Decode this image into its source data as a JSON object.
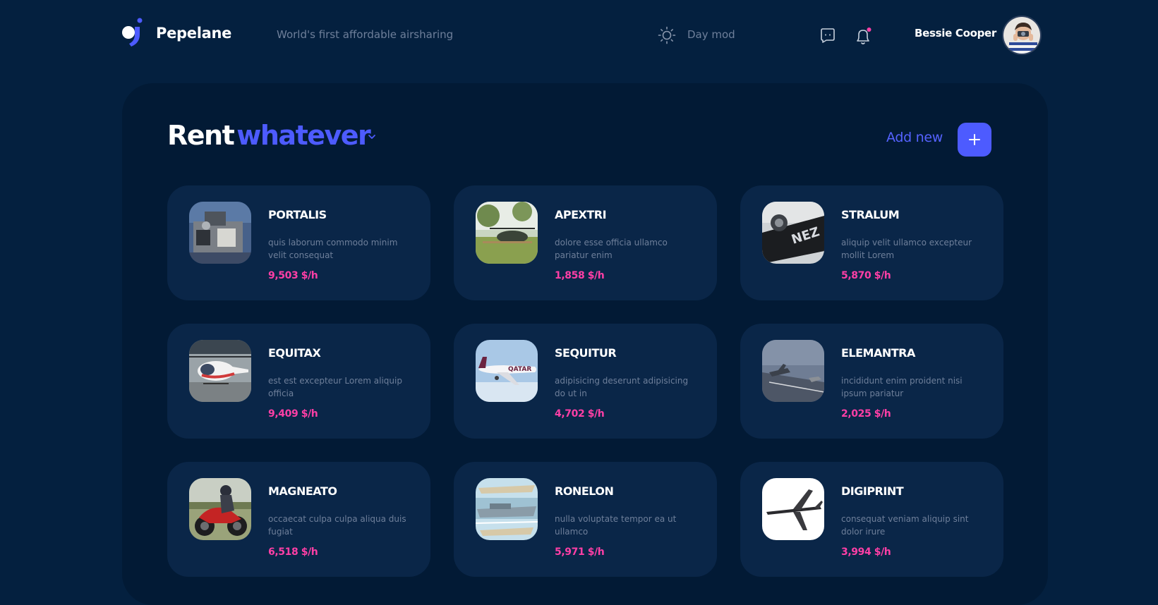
{
  "header": {
    "brand": "Pepelane",
    "tagline": "World's first affordable airsharing",
    "day_mode_label": "Day mod",
    "username": "Bessie Cooper",
    "icons": [
      "logo-icon",
      "sun-icon",
      "message-icon",
      "bell-icon"
    ]
  },
  "main": {
    "title_part1": "Rent",
    "title_part2": "whatever",
    "add_new_label": "Add new",
    "add_button_symbol": "+"
  },
  "colors": {
    "background": "#04203f",
    "panel": "#021a35",
    "card": "#0a2648",
    "accent": "#4d5bff",
    "price": "#ff3fa6",
    "muted": "#6e7f9a"
  },
  "cards": [
    {
      "name": "PORTALIS",
      "desc": "quis laborum commodo minim velit consequat",
      "price": "9,503 $/h",
      "image": "boat"
    },
    {
      "name": "APEXTRI",
      "desc": "dolore esse officia ullamco pariatur enim",
      "price": "1,858 $/h",
      "image": "park-helicopter"
    },
    {
      "name": "STRALUM",
      "desc": "aliquip velit ullamco excepteur mollit Lorem",
      "price": "5,870 $/h",
      "image": "jet-engine"
    },
    {
      "name": "EQUITAX",
      "desc": "est est excepteur Lorem aliquip officia",
      "price": "9,409 $/h",
      "image": "helicopter"
    },
    {
      "name": "SEQUITUR",
      "desc": "adipisicing deserunt adipisicing do ut in",
      "price": "4,702 $/h",
      "image": "airliner"
    },
    {
      "name": "ELEMANTRA",
      "desc": "incididunt enim proident nisi ipsum pariatur",
      "price": "2,025 $/h",
      "image": "fighter-jet"
    },
    {
      "name": "MAGNEATO",
      "desc": "occaecat culpa culpa aliqua duis fugiat",
      "price": "6,518 $/h",
      "image": "motorcycle"
    },
    {
      "name": "RONELON",
      "desc": "nulla voluptate tempor ea ut ullamco",
      "price": "5,971 $/h",
      "image": "ships"
    },
    {
      "name": "DIGIPRINT",
      "desc": "consequat veniam aliquip sint dolor irure",
      "price": "3,994 $/h",
      "image": "jet-plane"
    }
  ]
}
